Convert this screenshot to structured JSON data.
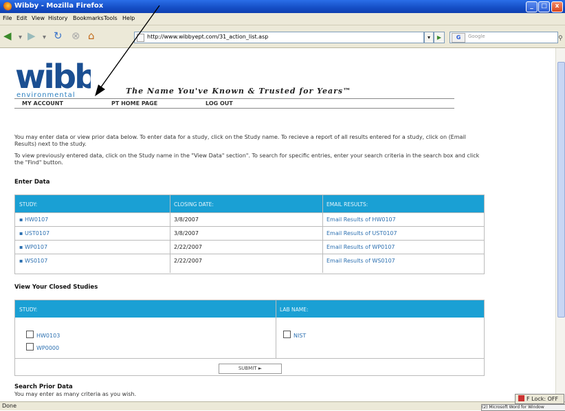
{
  "window": {
    "title": "Wibby - Mozilla Firefox",
    "min": "_",
    "max": "□",
    "close": "x"
  },
  "menu": [
    "File",
    "Edit",
    "View",
    "History",
    "Bookmarks",
    "Tools",
    "Help"
  ],
  "nav": {
    "url": "http://www.wibbyept.com/31_action_list.asp",
    "search_placeholder": "Google",
    "search_engine_icon": "G"
  },
  "logo": {
    "word": "wibby",
    "sub": "environmental"
  },
  "tagline": "The Name You've Known & Trusted for Years™",
  "topnav": [
    "MY ACCOUNT",
    "PT HOME PAGE",
    "LOG OUT"
  ],
  "intro": {
    "p1": "You may enter data or view prior data below. To enter data for a study, click on the Study name. To recieve a report of all results entered for a study, click on (Email Results) next to the study.",
    "p2": "To view previously entered data, click on the Study name in the \"View Data\" section\". To search for specific entries, enter your search criteria in the search box and click the \"Find\" button."
  },
  "enter_data": {
    "heading": "Enter Data",
    "columns": [
      "STUDY:",
      "CLOSING DATE:",
      "EMAIL RESULTS:"
    ],
    "rows": [
      {
        "study": "HW0107",
        "date": "3/8/2007",
        "email": "Email Results of HW0107"
      },
      {
        "study": "UST0107",
        "date": "3/8/2007",
        "email": "Email Results of UST0107"
      },
      {
        "study": "WP0107",
        "date": "2/22/2007",
        "email": "Email Results of WP0107"
      },
      {
        "study": "WS0107",
        "date": "2/22/2007",
        "email": "Email Results of WS0107"
      }
    ]
  },
  "closed": {
    "heading": "View Your Closed Studies",
    "columns": [
      "STUDY:",
      "LAB NAME:"
    ],
    "studies": [
      "HW0103",
      "WP0000"
    ],
    "labs": [
      "NIST"
    ],
    "submit": "SUBMIT ►"
  },
  "search": {
    "heading": "Search Prior Data",
    "sub": "You may enter as many criteria as you wish."
  },
  "status": {
    "text": "Done",
    "flock": "F Lock: OFF",
    "task": "(2) Microsoft Word for Window"
  }
}
